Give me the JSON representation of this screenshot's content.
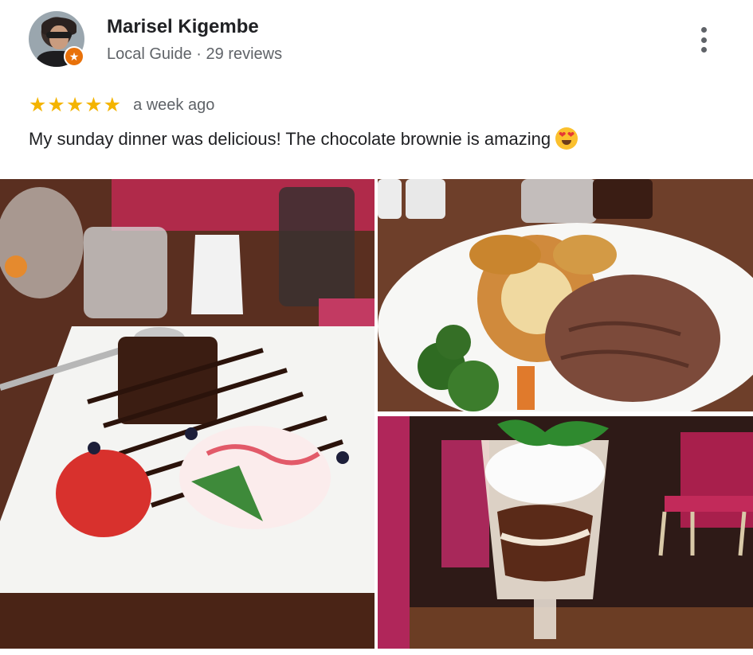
{
  "reviewer": {
    "name": "Marisel Kigembe",
    "meta": "Local Guide · 29 reviews",
    "badge_icon": "star-icon"
  },
  "review": {
    "rating": 5,
    "stars": "★★★★★",
    "time": "a week ago",
    "text": "My sunday dinner was delicious! The chocolate brownie is amazing",
    "emoji": "heart-eyes-emoji"
  },
  "colors": {
    "star": "#f4b400",
    "badge": "#e8710a",
    "meta_text": "#5f6368"
  },
  "photos": [
    {
      "subject": "brownie-dessert-plate"
    },
    {
      "subject": "roast-dinner-plate"
    },
    {
      "subject": "ice-cream-sundae"
    }
  ]
}
